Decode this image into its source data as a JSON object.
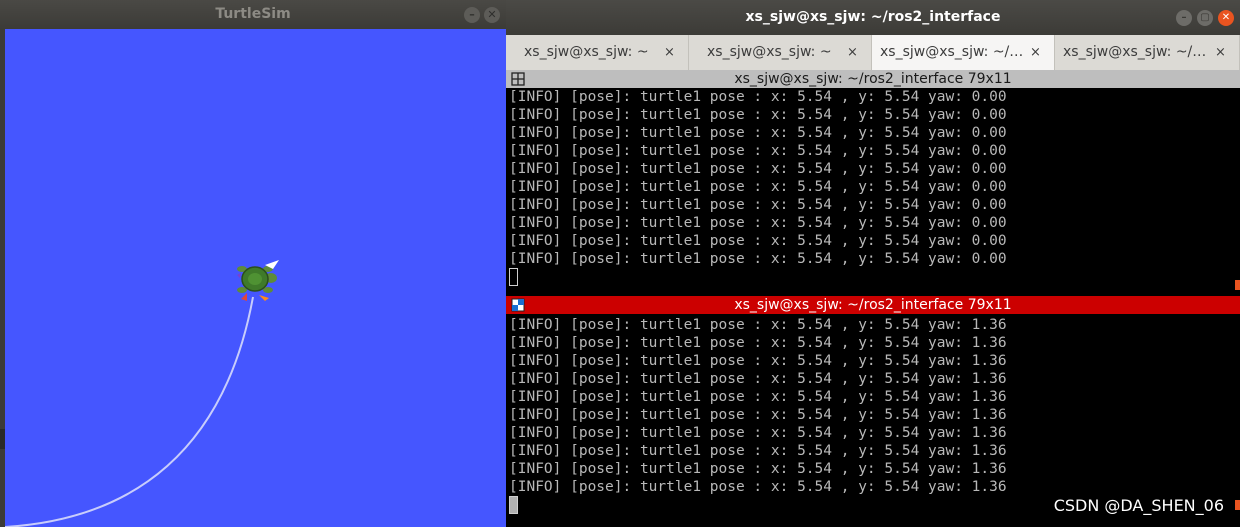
{
  "turtlesim": {
    "title": "TurtleSim",
    "minimize_glyph": "–",
    "close_glyph": "✕",
    "background_color": "#4556ff",
    "path_color": "#b9c4ff"
  },
  "terminal": {
    "title": "xs_sjw@xs_sjw: ~/ros2_interface",
    "minimize_glyph": "–",
    "maximize_glyph": "▢",
    "close_glyph": "✕",
    "tabs": [
      {
        "label": "xs_sjw@xs_sjw: ~",
        "close": "×"
      },
      {
        "label": "xs_sjw@xs_sjw: ~",
        "close": "×"
      },
      {
        "label": "xs_sjw@xs_sjw: ~/…",
        "close": "×"
      },
      {
        "label": "xs_sjw@xs_sjw: ~/…",
        "close": "×"
      }
    ],
    "top_pane": {
      "header": "xs_sjw@xs_sjw: ~/ros2_interface 79x11",
      "lines": [
        "[INFO] [pose]: turtle1 pose : x: 5.54 , y: 5.54 yaw: 0.00",
        "[INFO] [pose]: turtle1 pose : x: 5.54 , y: 5.54 yaw: 0.00",
        "[INFO] [pose]: turtle1 pose : x: 5.54 , y: 5.54 yaw: 0.00",
        "[INFO] [pose]: turtle1 pose : x: 5.54 , y: 5.54 yaw: 0.00",
        "[INFO] [pose]: turtle1 pose : x: 5.54 , y: 5.54 yaw: 0.00",
        "[INFO] [pose]: turtle1 pose : x: 5.54 , y: 5.54 yaw: 0.00",
        "[INFO] [pose]: turtle1 pose : x: 5.54 , y: 5.54 yaw: 0.00",
        "[INFO] [pose]: turtle1 pose : x: 5.54 , y: 5.54 yaw: 0.00",
        "[INFO] [pose]: turtle1 pose : x: 5.54 , y: 5.54 yaw: 0.00",
        "[INFO] [pose]: turtle1 pose : x: 5.54 , y: 5.54 yaw: 0.00"
      ]
    },
    "bottom_pane": {
      "header": "xs_sjw@xs_sjw: ~/ros2_interface 79x11",
      "lines": [
        "[INFO] [pose]: turtle1 pose : x: 5.54 , y: 5.54 yaw: 1.36",
        "[INFO] [pose]: turtle1 pose : x: 5.54 , y: 5.54 yaw: 1.36",
        "[INFO] [pose]: turtle1 pose : x: 5.54 , y: 5.54 yaw: 1.36",
        "[INFO] [pose]: turtle1 pose : x: 5.54 , y: 5.54 yaw: 1.36",
        "[INFO] [pose]: turtle1 pose : x: 5.54 , y: 5.54 yaw: 1.36",
        "[INFO] [pose]: turtle1 pose : x: 5.54 , y: 5.54 yaw: 1.36",
        "[INFO] [pose]: turtle1 pose : x: 5.54 , y: 5.54 yaw: 1.36",
        "[INFO] [pose]: turtle1 pose : x: 5.54 , y: 5.54 yaw: 1.36",
        "[INFO] [pose]: turtle1 pose : x: 5.54 , y: 5.54 yaw: 1.36",
        "[INFO] [pose]: turtle1 pose : x: 5.54 , y: 5.54 yaw: 1.36"
      ]
    },
    "active_pane_color": "#cc0000",
    "inactive_pane_color": "#bebebe"
  },
  "watermark": "CSDN @DA_SHEN_06"
}
